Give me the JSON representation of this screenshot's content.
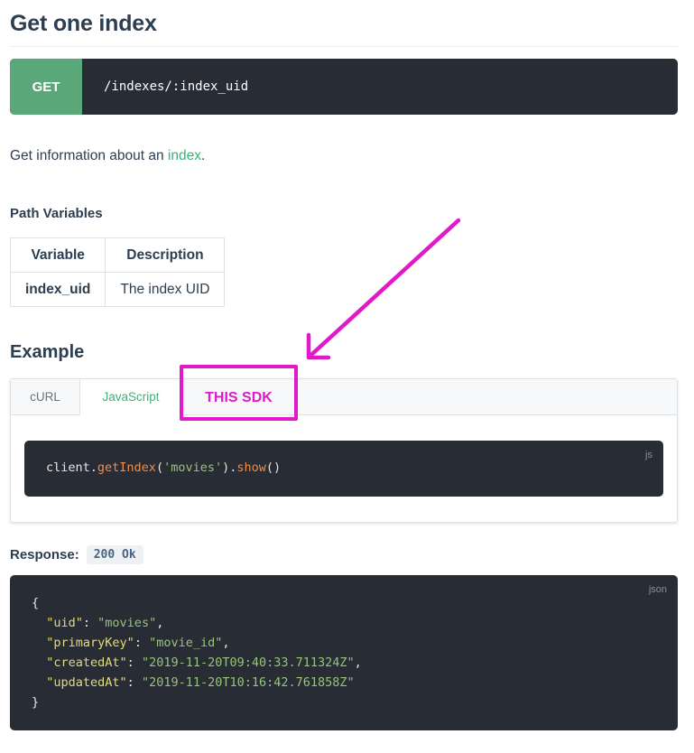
{
  "page": {
    "title": "Get one index",
    "endpoint": {
      "method": "GET",
      "path": "/indexes/:index_uid"
    },
    "intro": {
      "before": "Get information about an ",
      "link": "index",
      "after": "."
    },
    "path_variables": {
      "heading": "Path Variables",
      "headers": [
        "Variable",
        "Description"
      ],
      "rows": [
        {
          "variable": "index_uid",
          "description": "The index UID"
        }
      ]
    },
    "example": {
      "heading": "Example",
      "tabs": [
        "cURL",
        "JavaScript"
      ],
      "active_tab": "JavaScript",
      "code_lang": "js",
      "code": {
        "obj": "client.",
        "fn1": "getIndex",
        "p1": "(",
        "arg": "'movies'",
        "p2": ").",
        "fn2": "show",
        "p3": "()"
      }
    },
    "annotation": {
      "label": "THIS SDK",
      "color": "#e019c9"
    },
    "response": {
      "label": "Response:",
      "status": "200 Ok",
      "lang": "json",
      "open": "{",
      "close": "}",
      "fields": [
        {
          "key": "\"uid\"",
          "value": "\"movies\"",
          "sep": ","
        },
        {
          "key": "\"primaryKey\"",
          "value": "\"movie_id\"",
          "sep": ","
        },
        {
          "key": "\"createdAt\"",
          "value": "\"2019-11-20T09:40:33.711324Z\"",
          "sep": ","
        },
        {
          "key": "\"updatedAt\"",
          "value": "\"2019-11-20T10:16:42.761858Z\"",
          "sep": ""
        }
      ]
    }
  },
  "colors": {
    "accent_green": "#3eaf7c",
    "method_green": "#5aa779",
    "code_bg": "#282c34",
    "highlight_magenta": "#e019c9"
  }
}
